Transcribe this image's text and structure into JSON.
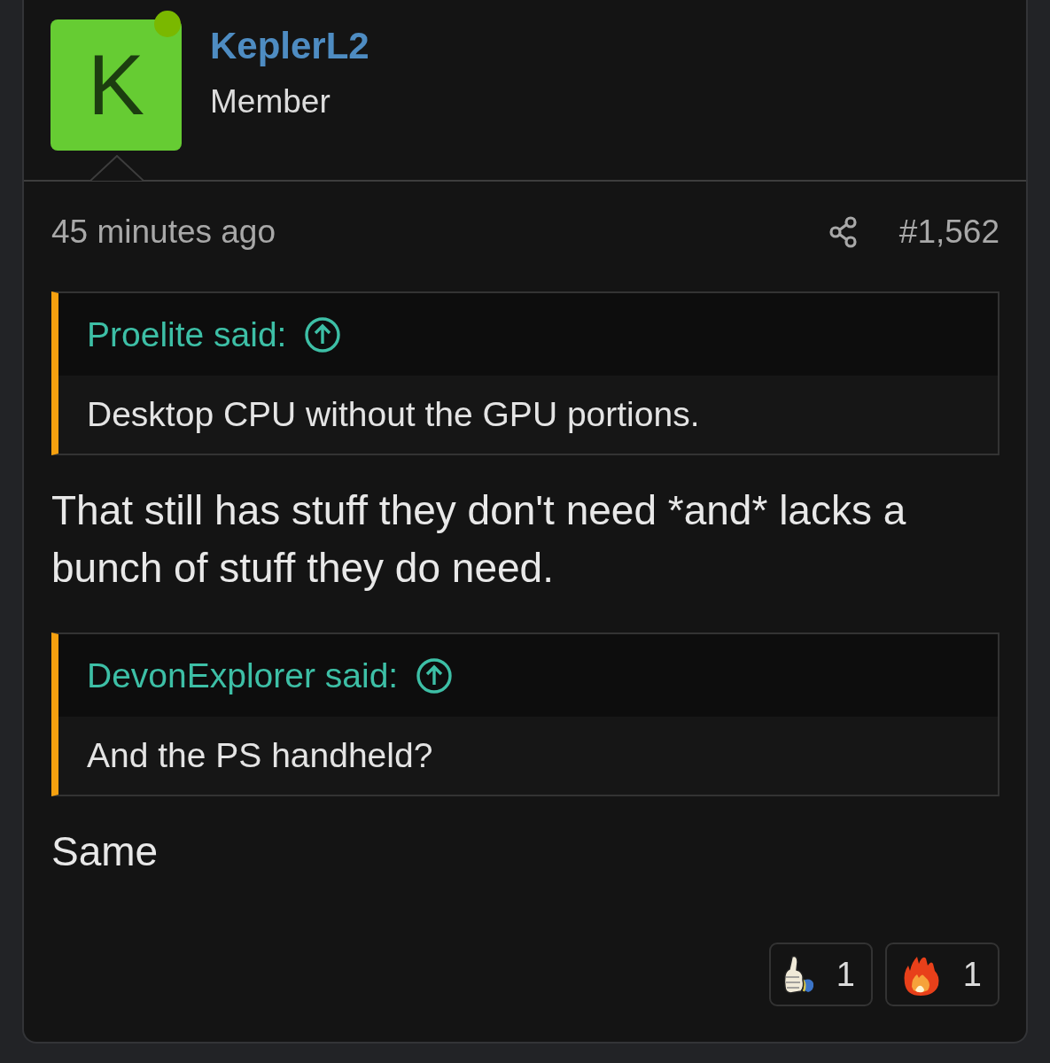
{
  "author": {
    "avatar_letter": "K",
    "online": true,
    "name": "KeplerL2",
    "title": "Member"
  },
  "post": {
    "time": "45 minutes ago",
    "number": "#1,562"
  },
  "body": [
    {
      "kind": "quote",
      "attribution": "Proelite said:",
      "text": "Desktop CPU without the GPU portions."
    },
    {
      "kind": "paragraph",
      "text": "That still has stuff they don't need *and* lacks a bunch of stuff they do need."
    },
    {
      "kind": "quote",
      "attribution": "DevonExplorer said:",
      "text": "And the PS handheld?"
    },
    {
      "kind": "paragraph",
      "text": "Same"
    }
  ],
  "reactions": [
    {
      "kind": "like",
      "count": "1"
    },
    {
      "kind": "fire",
      "count": "1"
    }
  ]
}
